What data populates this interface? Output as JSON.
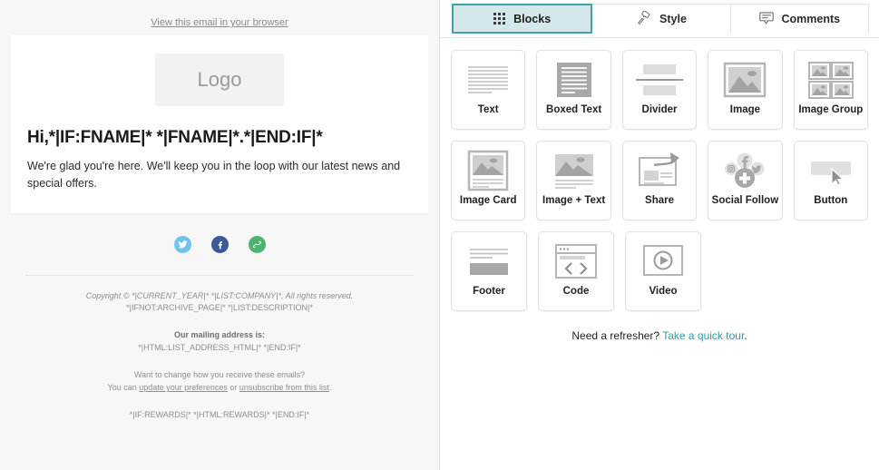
{
  "preview": {
    "view_in_browser": "View this email in your browser",
    "logo_text": "Logo",
    "heading": "Hi,*|IF:FNAME|* *|FNAME|*.*|END:IF|*",
    "body": "We're glad you're here. We'll keep you in the loop with our latest news and special offers.",
    "social": [
      {
        "name": "twitter-icon",
        "color": "#6dc5ef"
      },
      {
        "name": "facebook-icon",
        "color": "#3b5998"
      },
      {
        "name": "link-icon",
        "color": "#4db36f"
      }
    ],
    "footer": {
      "copyright_line": "Copyright © *|CURRENT_YEAR|* *|LIST:COMPANY|*, All rights reserved.",
      "description_line": "*|IFNOT:ARCHIVE_PAGE|* *|LIST:DESCRIPTION|*",
      "mailing_heading": "Our mailing address is:",
      "mailing_address": "*|HTML:LIST_ADDRESS_HTML|* *|END:IF|*",
      "change_question": "Want to change how you receive these emails?",
      "change_prefix": "You can ",
      "update_link": "update your preferences",
      "change_middle": " or ",
      "unsubscribe_link": "unsubscribe from this list",
      "change_suffix": ".",
      "rewards_line": "*|IF:REWARDS|* *|HTML:REWARDS|* *|END:IF|*"
    }
  },
  "panel": {
    "tabs": [
      {
        "label": "Blocks",
        "icon": "grid-dots-icon",
        "active": true
      },
      {
        "label": "Style",
        "icon": "paint-roller-icon",
        "active": false
      },
      {
        "label": "Comments",
        "icon": "comment-bubble-icon",
        "active": false
      }
    ],
    "blocks": [
      [
        {
          "label": "Text",
          "icon": "text-lines-icon"
        },
        {
          "label": "Boxed Text",
          "icon": "boxed-text-icon"
        },
        {
          "label": "Divider",
          "icon": "divider-icon"
        },
        {
          "label": "Image",
          "icon": "image-icon"
        },
        {
          "label": "Image Group",
          "icon": "image-group-icon"
        }
      ],
      [
        {
          "label": "Image Card",
          "icon": "image-card-icon"
        },
        {
          "label": "Image + Text",
          "icon": "image-text-icon"
        },
        {
          "label": "Share",
          "icon": "share-arrow-icon"
        },
        {
          "label": "Social Follow",
          "icon": "social-follow-icon"
        },
        {
          "label": "Button",
          "icon": "button-cursor-icon"
        }
      ],
      [
        {
          "label": "Footer",
          "icon": "footer-icon"
        },
        {
          "label": "Code",
          "icon": "code-brackets-icon"
        },
        {
          "label": "Video",
          "icon": "video-play-icon"
        }
      ]
    ],
    "refresher_text": "Need a refresher? ",
    "refresher_link": "Take a quick tour",
    "refresher_suffix": ".",
    "accent_color": "#41a0ab",
    "active_tab_fill": "#d3e8ea"
  }
}
